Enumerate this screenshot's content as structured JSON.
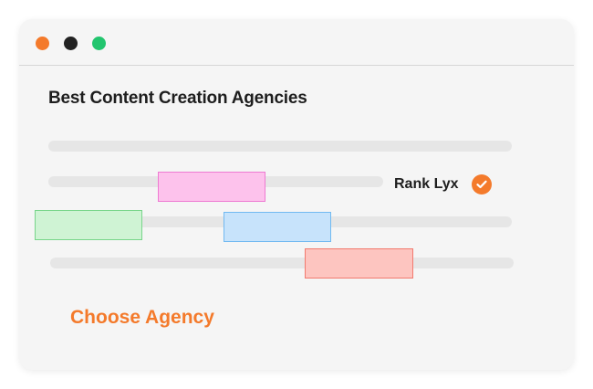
{
  "window": {
    "traffic_lights": [
      "#f47a2b",
      "#222222",
      "#22c56e"
    ]
  },
  "page": {
    "title": "Best Content Creation Agencies",
    "rank_label": "Rank Lyx",
    "cta": "Choose Agency"
  },
  "colors": {
    "accent": "#f47a2b",
    "pink_fill": "#fdc2ec",
    "pink_border": "#ee7ad2",
    "green_fill": "#cff3d4",
    "green_border": "#78d58a",
    "blue_fill": "#c7e3fb",
    "blue_border": "#71b9f1",
    "red_fill": "#fdc5c0",
    "red_border": "#f27a6e"
  },
  "icons": {
    "check": "check-circle-icon"
  }
}
